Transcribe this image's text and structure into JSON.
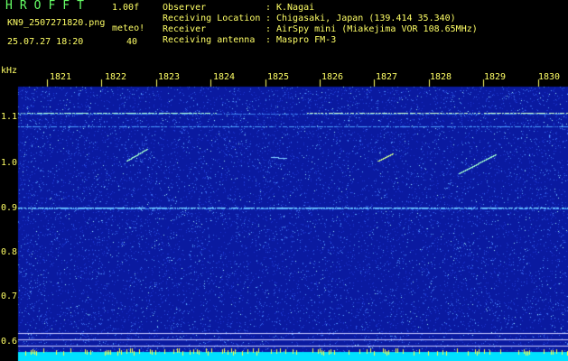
{
  "header": {
    "app_title": "HROFFT",
    "version": "1.00f",
    "filename": "KN9_2507271820.png",
    "meteo_label": "meteo!",
    "datetime": "25.07.27 18:20",
    "meteo_value": "40"
  },
  "info": [
    {
      "label": "Observer",
      "value": "K.Nagai"
    },
    {
      "label": "Receiving Location",
      "value": "Chigasaki, Japan (139.414 35.340)"
    },
    {
      "label": "Receiver",
      "value": "AirSpy mini (Miakejima VOR 108.65MHz)"
    },
    {
      "label": "Receiving antenna",
      "value": "Maspro FM-3"
    }
  ],
  "axis": {
    "y_unit": "kHz",
    "y_ticks": [
      "1.1",
      "1.0",
      "0.9",
      "0.8",
      "0.7",
      "0.6"
    ],
    "x_ticks": [
      "1821",
      "1822",
      "1823",
      "1824",
      "1825",
      "1826",
      "1827",
      "1828",
      "1829",
      "1830"
    ]
  },
  "colors": {
    "background": "#000000",
    "spectrogram_bg": "#0a1aa0",
    "text": "#ffff66",
    "title": "#66ff66",
    "trace": "#66e0ff",
    "baseline": "#00e0ff"
  }
}
